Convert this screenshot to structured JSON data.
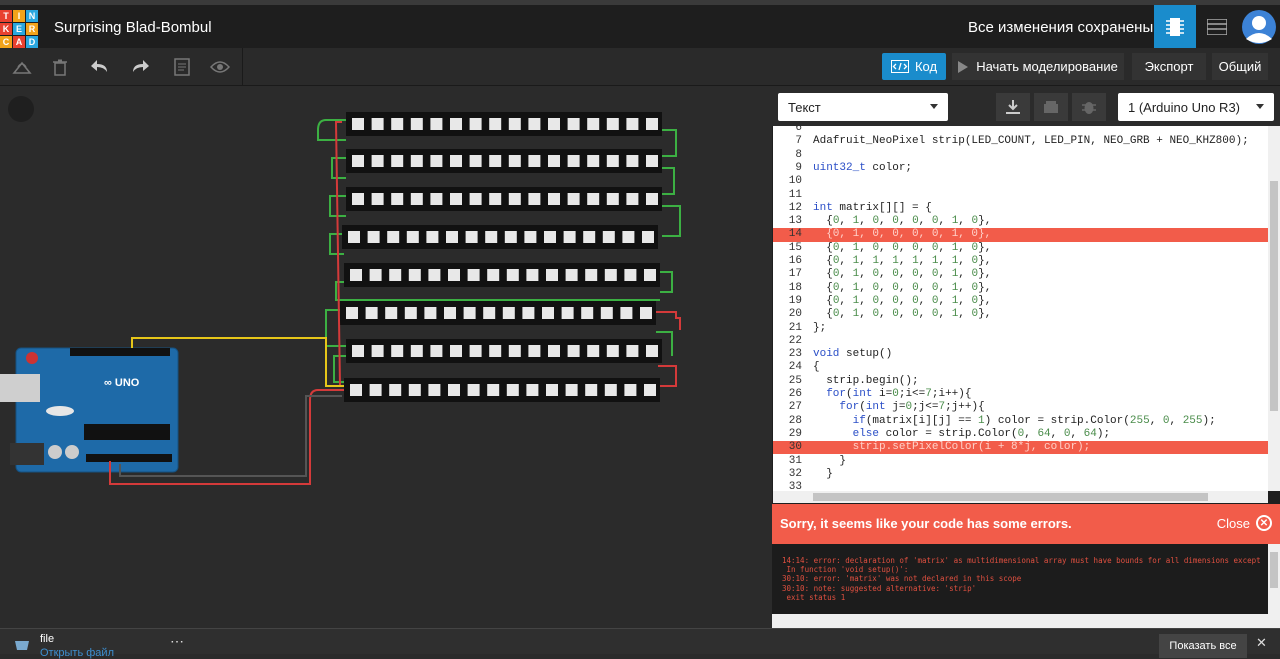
{
  "app": {
    "logo_letters": [
      "T",
      "I",
      "N",
      "K",
      "E",
      "R",
      "C",
      "A",
      "D"
    ],
    "logo_colors": [
      "#e8412f",
      "#f2a31a",
      "#2aa7df",
      "#e8412f",
      "#2aa7df",
      "#f2a31a",
      "#f2a31a",
      "#e8412f",
      "#2aa7df"
    ],
    "project_title": "Surprising Blad-Bombul",
    "save_status": "Все изменения сохранены"
  },
  "toolbar": {
    "code_label": "Код",
    "simulate_label": "Начать моделирование",
    "export_label": "Экспорт",
    "share_label": "Общий"
  },
  "code_panel": {
    "mode_select": "Текст",
    "device_select": "1 (Arduino Uno R3)",
    "lines": [
      {
        "n": "6",
        "t": ""
      },
      {
        "n": "7",
        "t": "Adafruit_NeoPixel strip(LED_COUNT, LED_PIN, NEO_GRB + NEO_KHZ800);"
      },
      {
        "n": "8",
        "t": ""
      },
      {
        "n": "9",
        "t": "uint32_t color;"
      },
      {
        "n": "10",
        "t": ""
      },
      {
        "n": "11",
        "t": ""
      },
      {
        "n": "12",
        "t": "int matrix[][] = {"
      },
      {
        "n": "13",
        "t": "  {0, 1, 0, 0, 0, 0, 1, 0},"
      },
      {
        "n": "14",
        "t": "  {0, 1, 0, 0, 0, 0, 1, 0},",
        "error": true
      },
      {
        "n": "15",
        "t": "  {0, 1, 0, 0, 0, 0, 1, 0},"
      },
      {
        "n": "16",
        "t": "  {0, 1, 1, 1, 1, 1, 1, 0},"
      },
      {
        "n": "17",
        "t": "  {0, 1, 0, 0, 0, 0, 1, 0},"
      },
      {
        "n": "18",
        "t": "  {0, 1, 0, 0, 0, 0, 1, 0},"
      },
      {
        "n": "19",
        "t": "  {0, 1, 0, 0, 0, 0, 1, 0},"
      },
      {
        "n": "20",
        "t": "  {0, 1, 0, 0, 0, 0, 1, 0},"
      },
      {
        "n": "21",
        "t": "};"
      },
      {
        "n": "22",
        "t": ""
      },
      {
        "n": "23",
        "t": "void setup()"
      },
      {
        "n": "24",
        "t": "{"
      },
      {
        "n": "25",
        "t": "  strip.begin();"
      },
      {
        "n": "26",
        "t": "  for(int i=0;i<=7;i++){"
      },
      {
        "n": "27",
        "t": "    for(int j=0;j<=7;j++){"
      },
      {
        "n": "28",
        "t": "      if(matrix[i][j] == 1) color = strip.Color(255, 0, 255);"
      },
      {
        "n": "29",
        "t": "      else color = strip.Color(0, 64, 0, 64);"
      },
      {
        "n": "30",
        "t": "      strip.setPixelColor(i + 8*j, color);",
        "error": true
      },
      {
        "n": "31",
        "t": "    }"
      },
      {
        "n": "32",
        "t": "  }"
      },
      {
        "n": "33",
        "t": ""
      }
    ],
    "error_message": "Sorry, it seems like your code has some errors.",
    "close_label": "Close",
    "console_lines": [
      "14:14: error: declaration of 'matrix' as multidimensional array must have bounds for all dimensions except",
      " In function 'void setup()':",
      "30:10: error: 'matrix' was not declared in this scope",
      "30:10: note: suggested alternative: 'strip'",
      " exit status 1"
    ]
  },
  "footer": {
    "file_label": "file",
    "file_link": "Открыть файл",
    "show_all": "Показать все"
  },
  "colors": {
    "accent": "#1a8ccc",
    "error": "#f25c4a",
    "wire_green": "#3cb043",
    "wire_red": "#d43a3a",
    "wire_yellow": "#e6c619",
    "arduino_blue": "#1e6aa8"
  }
}
